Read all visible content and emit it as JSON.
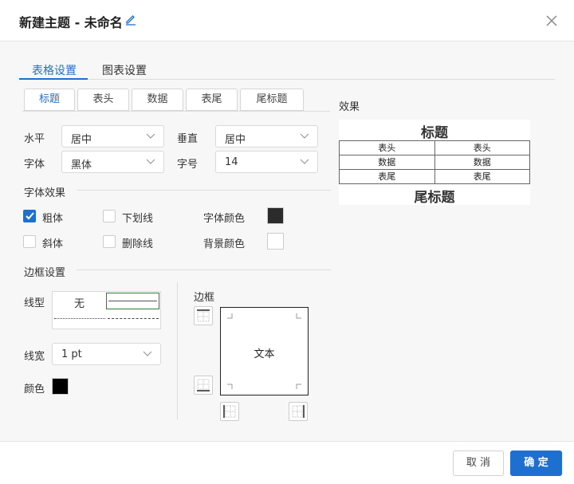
{
  "dialog": {
    "title": "新建主题 - 未命名",
    "close_icon": "close-icon",
    "edit_icon": "pencil-icon"
  },
  "top_tabs": [
    {
      "label": "表格设置",
      "active": true
    },
    {
      "label": "图表设置",
      "active": false
    }
  ],
  "sub_tabs": [
    {
      "label": "标题",
      "active": true
    },
    {
      "label": "表头",
      "active": false
    },
    {
      "label": "数据",
      "active": false
    },
    {
      "label": "表尾",
      "active": false
    },
    {
      "label": "尾标题",
      "active": false
    }
  ],
  "alignment": {
    "horizontal_label": "水平",
    "horizontal_value": "居中",
    "vertical_label": "垂直",
    "vertical_value": "居中"
  },
  "font": {
    "family_label": "字体",
    "family_value": "黑体",
    "size_label": "字号",
    "size_value": "14"
  },
  "font_effects": {
    "section_title": "字体效果",
    "bold_label": "粗体",
    "bold_checked": true,
    "underline_label": "下划线",
    "underline_checked": false,
    "italic_label": "斜体",
    "italic_checked": false,
    "strike_label": "删除线",
    "strike_checked": false,
    "font_color_label": "字体颜色",
    "font_color": "#2b2b2b",
    "bg_color_label": "背景颜色",
    "bg_color": "#ffffff"
  },
  "border_settings": {
    "section_title": "边框设置",
    "line_type_label": "线型",
    "line_type_none": "无",
    "line_width_label": "线宽",
    "line_width_value": "1 pt",
    "color_label": "颜色",
    "color": "#000000",
    "border_label": "边框",
    "border_box_text": "文本"
  },
  "preview": {
    "section_title": "效果",
    "title": "标题",
    "rows": [
      [
        "表头",
        "表头"
      ],
      [
        "数据",
        "数据"
      ],
      [
        "表尾",
        "表尾"
      ]
    ],
    "footer_title": "尾标题"
  },
  "footer": {
    "cancel_label": "取 消",
    "ok_label": "确 定"
  },
  "colors": {
    "accent": "#1f6fd1"
  }
}
